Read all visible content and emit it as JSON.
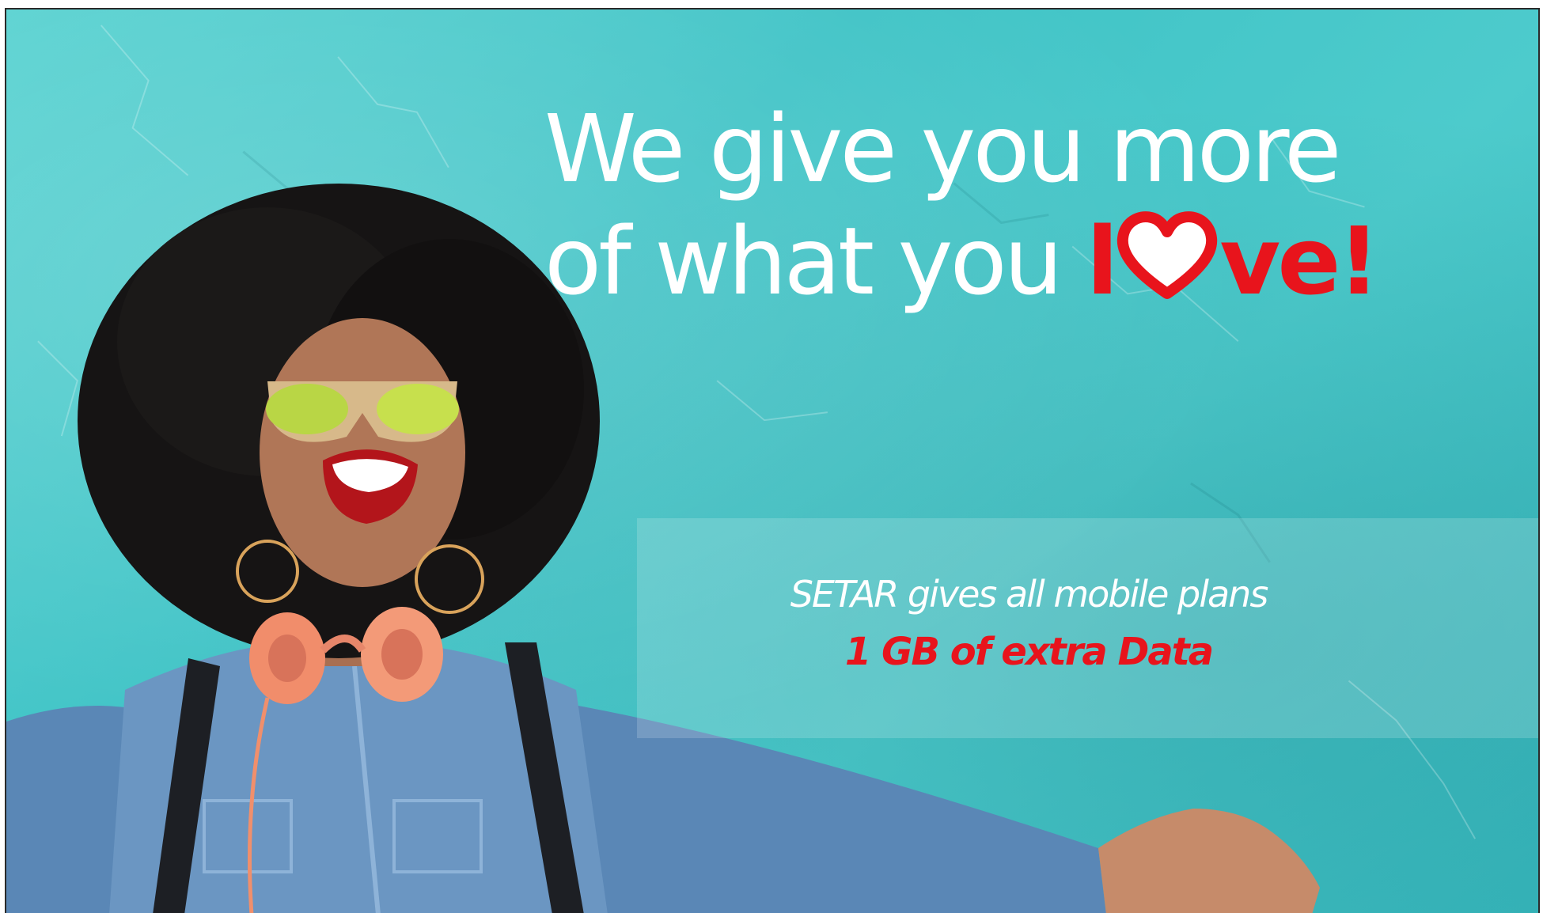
{
  "headline": {
    "line1": "We give you more",
    "line2_prefix": "of what you ",
    "love_l": "l",
    "love_heart_icon": "heart-icon",
    "love_rest": "ve!"
  },
  "offer": {
    "line1": "SETAR gives all mobile plans",
    "line2": "1 GB of extra Data"
  },
  "colors": {
    "background": "#4dcbcc",
    "accent_red": "#e8141c",
    "text_white": "#ffffff"
  }
}
